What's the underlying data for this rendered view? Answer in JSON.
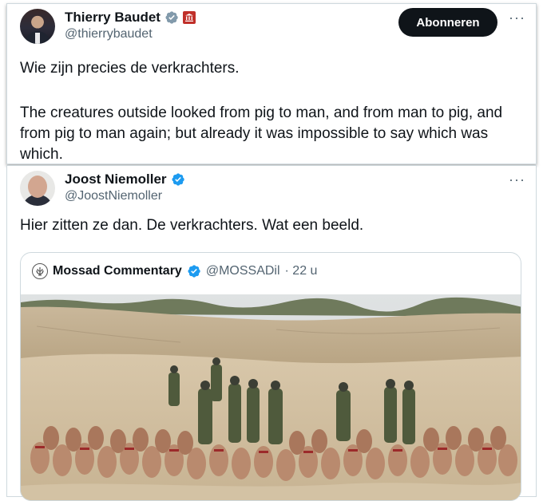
{
  "tweet1": {
    "author_name": "Thierry Baudet",
    "handle": "@thierrybaudet",
    "follow_label": "Abonneren",
    "more_label": "···",
    "line1": "Wie zijn precies de verkrachters.",
    "line2": "The creatures outside looked from pig to man, and from man to pig, and from pig to man again; but already it was impossible to say which was which."
  },
  "tweet2": {
    "author_name": "Joost Niemoller",
    "handle": "@JoostNiemoller",
    "more_label": "···",
    "text": "Hier zitten ze dan. De verkrachters. Wat een beeld.",
    "quote": {
      "author_name": "Mossad Commentary",
      "handle": "@MOSSADil",
      "time": "· 22 u"
    }
  },
  "icons": {
    "verified": "verified-badge-icon",
    "government": "government-building-icon",
    "more": "more-options-icon"
  },
  "colors": {
    "verified_blue": "#1d9bf0",
    "button_dark": "#0f1419",
    "secondary_text": "#536471",
    "gov_badge_red": "#c0302a"
  }
}
